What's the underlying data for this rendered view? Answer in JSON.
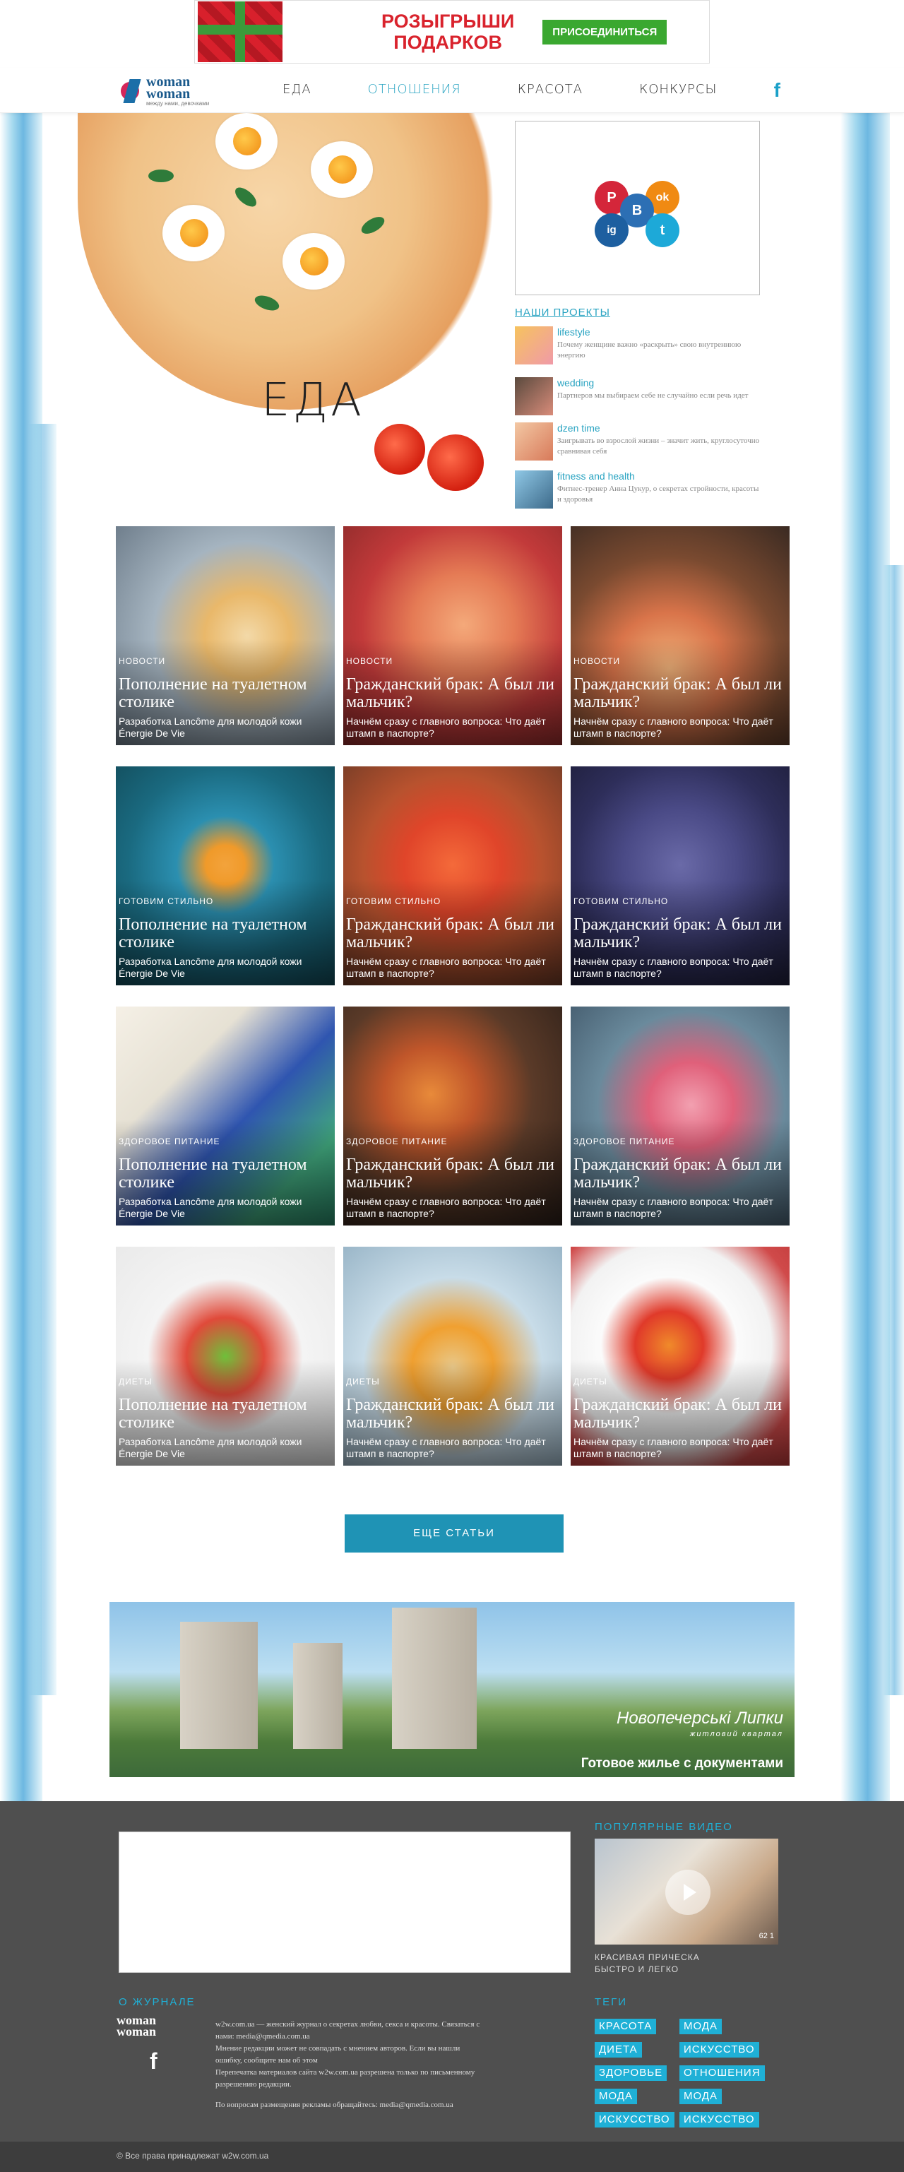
{
  "ad_top": {
    "headline_line1": "РОЗЫГРЫШИ",
    "headline_line2": "ПОДАРКОВ",
    "button": "ПРИСОЕДИНИТЬСЯ"
  },
  "header": {
    "logo_top": "woman",
    "logo_bottom": "woman",
    "logo_tagline": "между нами, девочками",
    "nav": [
      "ЕДА",
      "ОТНОШЕНИЯ",
      "КРАСОТА",
      "КОНКУРСЫ"
    ],
    "active_nav": "ОТНОШЕНИЯ",
    "facebook_glyph": "f"
  },
  "hero": {
    "title": "ЕДА"
  },
  "social": {
    "items": [
      "P",
      "ok",
      "B",
      "ig",
      "t"
    ]
  },
  "projects": {
    "title": "НАШИ ПРОЕКТЫ",
    "items": [
      {
        "name": "lifestyle",
        "desc": "Почему женщине важно «раскрыть» свою внутреннюю энергию"
      },
      {
        "name": "wedding",
        "desc": "Партнеров мы выбираем себе не случайно если речь идет"
      },
      {
        "name": "dzen time",
        "desc": "Заигрывать во взрослой жизни – значит жить, круглосуточно сравнивая себя"
      },
      {
        "name": "fitness and health",
        "desc": "Фитнес-тренер Анна Цукур, о секретах стройности, красоты и здоровья"
      }
    ]
  },
  "articles": [
    {
      "cat": "НОВОСТИ",
      "title": "Пополнение на туалетном столике",
      "desc": "Разработка Lancôme для молодой кожи Énergie De Vie"
    },
    {
      "cat": "НОВОСТИ",
      "title": "Гражданский брак: А был ли мальчик?",
      "desc": "Начнём сразу с главного вопроса: Что даёт штамп в паспорте?"
    },
    {
      "cat": "НОВОСТИ",
      "title": "Гражданский брак: А был ли мальчик?",
      "desc": "Начнём сразу с главного вопроса: Что даёт штамп в паспорте?"
    },
    {
      "cat": "ГОТОВИМ СТИЛЬНО",
      "title": "Пополнение на туалетном столике",
      "desc": "Разработка Lancôme для молодой кожи Énergie De Vie"
    },
    {
      "cat": "ГОТОВИМ СТИЛЬНО",
      "title": "Гражданский брак: А был ли мальчик?",
      "desc": "Начнём сразу с главного вопроса: Что даёт штамп в паспорте?"
    },
    {
      "cat": "ГОТОВИМ СТИЛЬНО",
      "title": "Гражданский брак: А был ли мальчик?",
      "desc": "Начнём сразу с главного вопроса: Что даёт штамп в паспорте?"
    },
    {
      "cat": "ЗДОРОВОЕ ПИТАНИЕ",
      "title": "Пополнение на туалетном столике",
      "desc": "Разработка Lancôme для молодой кожи Énergie De Vie"
    },
    {
      "cat": "ЗДОРОВОЕ ПИТАНИЕ",
      "title": "Гражданский брак: А был ли мальчик?",
      "desc": "Начнём сразу с главного вопроса: Что даёт штамп в паспорте?"
    },
    {
      "cat": "ЗДОРОВОЕ ПИТАНИЕ",
      "title": "Гражданский брак: А был ли мальчик?",
      "desc": "Начнём сразу с главного вопроса: Что даёт штамп в паспорте?"
    },
    {
      "cat": "ДИЕТЫ",
      "title": "Пополнение на туалетном столике",
      "desc": "Разработка Lancôme для молодой кожи Énergie De Vie"
    },
    {
      "cat": "ДИЕТЫ",
      "title": "Гражданский брак: А был ли мальчик?",
      "desc": "Начнём сразу с главного вопроса: Что даёт штамп в паспорте?"
    },
    {
      "cat": "ДИЕТЫ",
      "title": "Гражданский брак: А был ли мальчик?",
      "desc": "Начнём сразу с главного вопроса: Что даёт штамп в паспорте?"
    }
  ],
  "more_button": "ЕЩЕ СТАТЬИ",
  "ad_bottom": {
    "brand": "Новопечерські Липки",
    "subtitle": "житловий квартал",
    "cta": "Готовое жилье с документами"
  },
  "footer": {
    "popular_video_title": "ПОПУЛЯРНЫЕ ВИДЕО",
    "video_stats": "62   1",
    "video_caption": "КРАСИВАЯ ПРИЧЕСКА БЫСТРО И ЛЕГКО",
    "about_title": "О ЖУРНАЛЕ",
    "about_lines": [
      "w2w.com.ua — женский журнал о секретах любви, секса и красоты. Связаться с нами: media@qmedia.com.ua",
      "Мнение редакции может не совпадать с мнением авторов. Если вы нашли ошибку, сообщите нам об этом",
      "Перепечатка материалов сайта w2w.com.ua разрешена только по письменному разрешению редакции.",
      "По вопросам размещения рекламы обращайтесь: media@qmedia.com.ua"
    ],
    "tags_title": "ТЕГИ",
    "tags": [
      "КРАСОТА",
      "МОДА",
      "ДИЕТА",
      "ИСКУССТВО",
      "ЗДОРОВЬЕ",
      "ОТНОШЕНИЯ",
      "МОДА",
      "МОДА",
      "ИСКУССТВО",
      "ИСКУССТВО"
    ],
    "copyright": "© Все права принадлежат w2w.com.ua"
  }
}
